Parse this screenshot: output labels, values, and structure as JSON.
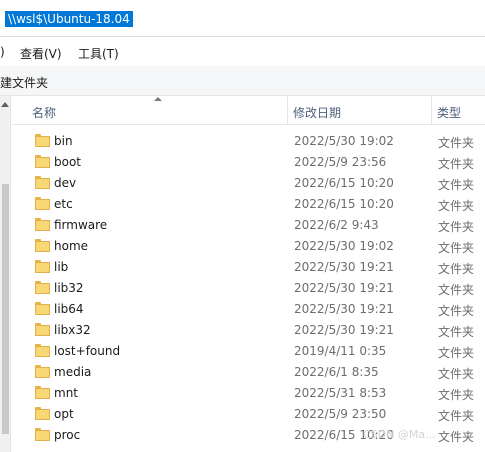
{
  "address": {
    "path": "\\\\wsl$\\Ubuntu-18.04"
  },
  "menu": {
    "items": [
      {
        "label": ")"
      },
      {
        "label": "查看(V)"
      },
      {
        "label": "工具(T)"
      }
    ]
  },
  "toolbar": {
    "new_folder_label": "建文件夹"
  },
  "columns": {
    "name": "名称",
    "date": "修改日期",
    "type": "类型"
  },
  "files": [
    {
      "name": "bin",
      "date": "2022/5/30 19:02",
      "type": "文件夹"
    },
    {
      "name": "boot",
      "date": "2022/5/9 23:56",
      "type": "文件夹"
    },
    {
      "name": "dev",
      "date": "2022/6/15 10:20",
      "type": "文件夹"
    },
    {
      "name": "etc",
      "date": "2022/6/15 10:20",
      "type": "文件夹"
    },
    {
      "name": "firmware",
      "date": "2022/6/2 9:43",
      "type": "文件夹"
    },
    {
      "name": "home",
      "date": "2022/5/30 19:02",
      "type": "文件夹"
    },
    {
      "name": "lib",
      "date": "2022/5/30 19:21",
      "type": "文件夹"
    },
    {
      "name": "lib32",
      "date": "2022/5/30 19:21",
      "type": "文件夹"
    },
    {
      "name": "lib64",
      "date": "2022/5/30 19:21",
      "type": "文件夹"
    },
    {
      "name": "libx32",
      "date": "2022/5/30 19:21",
      "type": "文件夹"
    },
    {
      "name": "lost+found",
      "date": "2019/4/11 0:35",
      "type": "文件夹"
    },
    {
      "name": "media",
      "date": "2022/6/1 8:35",
      "type": "文件夹"
    },
    {
      "name": "mnt",
      "date": "2022/5/31 8:53",
      "type": "文件夹"
    },
    {
      "name": "opt",
      "date": "2022/5/9 23:50",
      "type": "文件夹"
    },
    {
      "name": "proc",
      "date": "2022/6/15 10:20",
      "type": "文件夹"
    }
  ],
  "watermark": "CSDN @Ma..."
}
